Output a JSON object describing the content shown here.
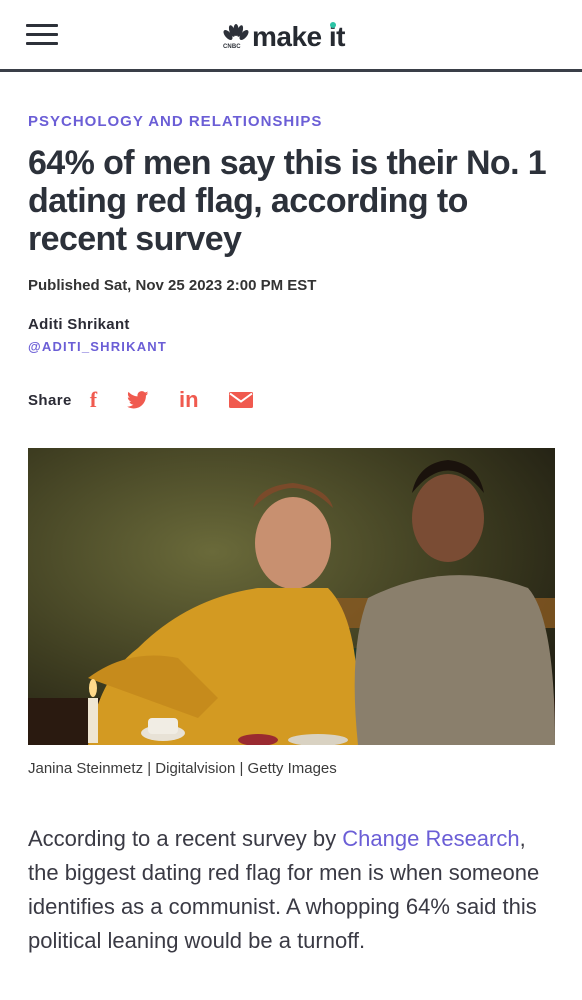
{
  "header": {
    "logo_sub": "CNBC",
    "logo_text": "make it"
  },
  "article": {
    "kicker": "PSYCHOLOGY AND RELATIONSHIPS",
    "headline": "64% of men say this is their No. 1 dating red flag, according to recent survey",
    "published": "Published Sat, Nov 25 2023 2:00 PM EST",
    "author": "Aditi Shrikant",
    "handle": "@ADITI_SHRIKANT",
    "share_label": "Share",
    "share_icons": [
      "facebook-icon",
      "twitter-icon",
      "linkedin-icon",
      "email-icon"
    ],
    "image_caption": "Janina Steinmetz | Digitalvision | Getty Images",
    "body": {
      "part1": "According to a recent survey by ",
      "link": "Change Research",
      "part2": ", the biggest dating red flag for men is when someone identifies as a communist. A whopping 64% said this political leaning would be a turnoff."
    }
  },
  "colors": {
    "accent": "#6b5ed6",
    "share": "#f05a4f",
    "logo_dot": "#2bc3a5"
  }
}
